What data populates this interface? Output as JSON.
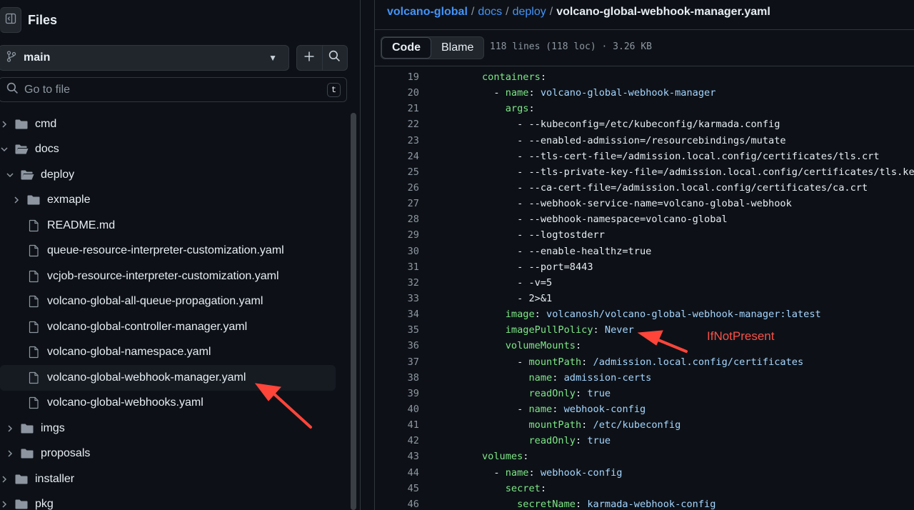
{
  "sidebar": {
    "title": "Files",
    "branch": "main",
    "search_placeholder": "Go to file",
    "search_shortcut": "t",
    "tree": [
      {
        "label": "cmd",
        "type": "folder",
        "depth": 0,
        "expanded": false
      },
      {
        "label": "docs",
        "type": "folder",
        "depth": 0,
        "expanded": true
      },
      {
        "label": "deploy",
        "type": "folder",
        "depth": 1,
        "expanded": true
      },
      {
        "label": "exmaple",
        "type": "folder",
        "depth": 2,
        "expanded": false
      },
      {
        "label": "README.md",
        "type": "file",
        "depth": 2
      },
      {
        "label": "queue-resource-interpreter-customization.yaml",
        "type": "file",
        "depth": 2
      },
      {
        "label": "vcjob-resource-interpreter-customization.yaml",
        "type": "file",
        "depth": 2
      },
      {
        "label": "volcano-global-all-queue-propagation.yaml",
        "type": "file",
        "depth": 2
      },
      {
        "label": "volcano-global-controller-manager.yaml",
        "type": "file",
        "depth": 2
      },
      {
        "label": "volcano-global-namespace.yaml",
        "type": "file",
        "depth": 2
      },
      {
        "label": "volcano-global-webhook-manager.yaml",
        "type": "file",
        "depth": 2,
        "selected": true
      },
      {
        "label": "volcano-global-webhooks.yaml",
        "type": "file",
        "depth": 2
      },
      {
        "label": "imgs",
        "type": "folder",
        "depth": 1,
        "expanded": false
      },
      {
        "label": "proposals",
        "type": "folder",
        "depth": 1,
        "expanded": false
      },
      {
        "label": "installer",
        "type": "folder",
        "depth": 0,
        "expanded": false
      },
      {
        "label": "pkg",
        "type": "folder",
        "depth": 0,
        "expanded": false
      }
    ]
  },
  "breadcrumb": {
    "repo": "volcano-global",
    "parts": [
      "docs",
      "deploy"
    ],
    "current": "volcano-global-webhook-manager.yaml",
    "separator": "/"
  },
  "file_bar": {
    "tab_code": "Code",
    "tab_blame": "Blame",
    "info": "118 lines (118 loc) · 3.26 KB"
  },
  "code_lines": [
    {
      "n": "19",
      "indent": 0,
      "dash": false,
      "key": "containers",
      "value": ""
    },
    {
      "n": "20",
      "indent": 1,
      "dash": true,
      "key": "name",
      "value": "volcano-global-webhook-manager"
    },
    {
      "n": "21",
      "indent": 2,
      "dash": false,
      "key": "args",
      "value": ""
    },
    {
      "n": "22",
      "indent": 3,
      "dash": true,
      "key": "",
      "value": "--kubeconfig=/etc/kubeconfig/karmada.config"
    },
    {
      "n": "23",
      "indent": 3,
      "dash": true,
      "key": "",
      "value": "--enabled-admission=/resourcebindings/mutate"
    },
    {
      "n": "24",
      "indent": 3,
      "dash": true,
      "key": "",
      "value": "--tls-cert-file=/admission.local.config/certificates/tls.crt"
    },
    {
      "n": "25",
      "indent": 3,
      "dash": true,
      "key": "",
      "value": "--tls-private-key-file=/admission.local.config/certificates/tls.key"
    },
    {
      "n": "26",
      "indent": 3,
      "dash": true,
      "key": "",
      "value": "--ca-cert-file=/admission.local.config/certificates/ca.crt"
    },
    {
      "n": "27",
      "indent": 3,
      "dash": true,
      "key": "",
      "value": "--webhook-service-name=volcano-global-webhook"
    },
    {
      "n": "28",
      "indent": 3,
      "dash": true,
      "key": "",
      "value": "--webhook-namespace=volcano-global"
    },
    {
      "n": "29",
      "indent": 3,
      "dash": true,
      "key": "",
      "value": "--logtostderr"
    },
    {
      "n": "30",
      "indent": 3,
      "dash": true,
      "key": "",
      "value": "--enable-healthz=true"
    },
    {
      "n": "31",
      "indent": 3,
      "dash": true,
      "key": "",
      "value": "--port=8443"
    },
    {
      "n": "32",
      "indent": 3,
      "dash": true,
      "key": "",
      "value": "-v=5"
    },
    {
      "n": "33",
      "indent": 3,
      "dash": true,
      "key": "",
      "value": "2>&1"
    },
    {
      "n": "34",
      "indent": 2,
      "dash": false,
      "key": "image",
      "value": "volcanosh/volcano-global-webhook-manager:latest"
    },
    {
      "n": "35",
      "indent": 2,
      "dash": false,
      "key": "imagePullPolicy",
      "value": "Never"
    },
    {
      "n": "36",
      "indent": 2,
      "dash": false,
      "key": "volumeMounts",
      "value": ""
    },
    {
      "n": "37",
      "indent": 3,
      "dash": true,
      "key": "mountPath",
      "value": "/admission.local.config/certificates"
    },
    {
      "n": "38",
      "indent": 4,
      "dash": false,
      "key": "name",
      "value": "admission-certs"
    },
    {
      "n": "39",
      "indent": 4,
      "dash": false,
      "key": "readOnly",
      "value": "true"
    },
    {
      "n": "40",
      "indent": 3,
      "dash": true,
      "key": "name",
      "value": "webhook-config"
    },
    {
      "n": "41",
      "indent": 4,
      "dash": false,
      "key": "mountPath",
      "value": "/etc/kubeconfig"
    },
    {
      "n": "42",
      "indent": 4,
      "dash": false,
      "key": "readOnly",
      "value": "true"
    },
    {
      "n": "43",
      "indent": 0,
      "dash": false,
      "key": "volumes",
      "value": ""
    },
    {
      "n": "44",
      "indent": 1,
      "dash": true,
      "key": "name",
      "value": "webhook-config"
    },
    {
      "n": "45",
      "indent": 2,
      "dash": false,
      "key": "secret",
      "value": ""
    },
    {
      "n": "46",
      "indent": 3,
      "dash": false,
      "key": "secretName",
      "value": "karmada-webhook-config"
    }
  ],
  "annotation": {
    "text": "IfNotPresent",
    "color": "#f85149"
  },
  "colors": {
    "background": "#0d1117",
    "link": "#4493f8",
    "yaml_key": "#7ee787",
    "yaml_value": "#a5d6ff",
    "arrow": "#ff453a"
  }
}
